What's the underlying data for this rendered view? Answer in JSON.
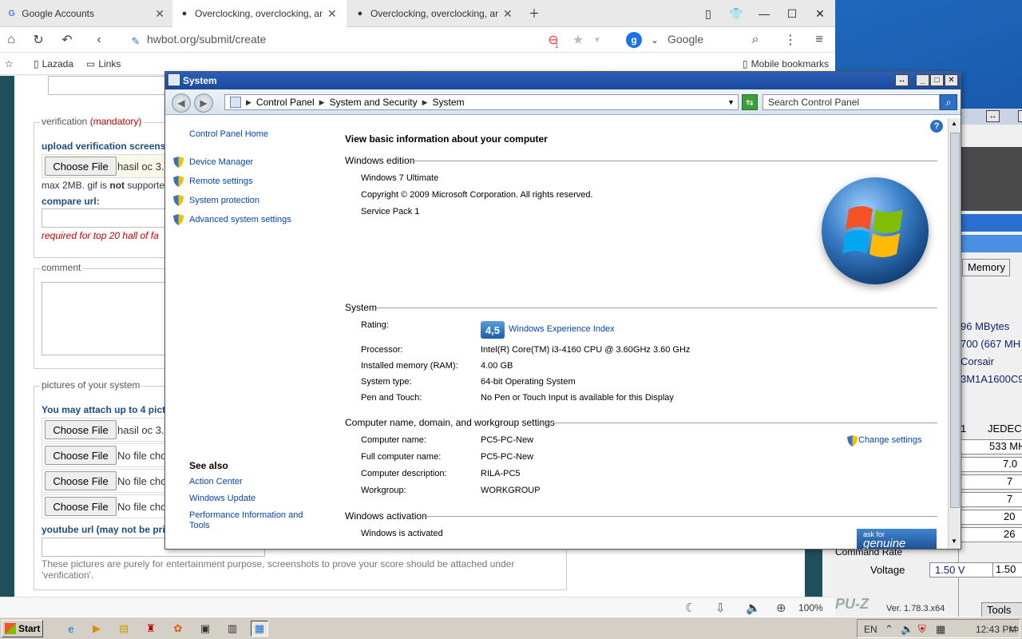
{
  "browser": {
    "tabs": [
      {
        "label": "Google Accounts",
        "active": false
      },
      {
        "label": "Overclocking, overclocking, and more",
        "active": true
      },
      {
        "label": "Overclocking, overclocking, and more",
        "active": false
      }
    ],
    "url": "hwbot.org/submit/create",
    "search_engine": "Google",
    "bookmarks": [
      "Lazada",
      "Links"
    ],
    "mobile_bookmarks": "Mobile bookmarks",
    "zoom": "100%",
    "blocked_count": "1"
  },
  "form": {
    "verification_legend": "verification",
    "mandatory": "(mandatory)",
    "upload_label": "upload verification screens",
    "choose_file": "Choose File",
    "file_selected": "hasil oc 3.",
    "max_note_a": "max 2MB. gif is ",
    "max_note_b": "not",
    "max_note_c": " supporte",
    "compare_url": "compare url:",
    "required_note": "required for top 20 hall of fa",
    "comment_legend": "comment",
    "pictures_legend": "pictures of your system",
    "attach_label": "You may attach up to 4 pictu",
    "pictures": [
      "hasil oc 3.",
      "No file cho",
      "No file cho",
      "No file cho"
    ],
    "youtube_label": "youtube url (may not be priv",
    "pictures_note": "These pictures are purely for entertainment purpose, screenshots to prove your score should be attached under 'verification'."
  },
  "system_window": {
    "title": "System",
    "breadcrumbs": [
      "Control Panel",
      "System and Security",
      "System"
    ],
    "search_placeholder": "Search Control Panel",
    "left_links": {
      "home": "Control Panel Home",
      "tasks": [
        "Device Manager",
        "Remote settings",
        "System protection",
        "Advanced system settings"
      ],
      "see_also": "See also",
      "see_also_links": [
        "Action Center",
        "Windows Update",
        "Performance Information and Tools"
      ]
    },
    "heading": "View basic information about your computer",
    "edition": {
      "title": "Windows edition",
      "name": "Windows 7 Ultimate",
      "copyright": "Copyright © 2009 Microsoft Corporation.  All rights reserved.",
      "service_pack": "Service Pack 1"
    },
    "system": {
      "title": "System",
      "rating_label": "Rating:",
      "rating_value": "4,5",
      "rating_link": "Windows Experience Index",
      "rows": [
        {
          "k": "Processor:",
          "v": "Intel(R) Core(TM) i3-4160 CPU @ 3.60GHz   3.60 GHz"
        },
        {
          "k": "Installed memory (RAM):",
          "v": "4.00 GB"
        },
        {
          "k": "System type:",
          "v": "64-bit Operating System"
        },
        {
          "k": "Pen and Touch:",
          "v": "No Pen or Touch Input is available for this Display"
        }
      ]
    },
    "computer": {
      "title": "Computer name, domain, and workgroup settings",
      "change": "Change settings",
      "rows": [
        {
          "k": "Computer name:",
          "v": "PC5-PC-New"
        },
        {
          "k": "Full computer name:",
          "v": "PC5-PC-New"
        },
        {
          "k": "Computer description:",
          "v": "RILA-PC5"
        },
        {
          "k": "Workgroup:",
          "v": "WORKGROUP"
        }
      ]
    },
    "activation": {
      "title": "Windows activation",
      "status": "Windows is activated",
      "genuine_a": "ask for",
      "genuine_b": "genuine"
    }
  },
  "cpuz": {
    "memory_tab": "Memory",
    "size": "96 MBytes",
    "freq": "700 (667 MH",
    "manuf": "Corsair",
    "part": "3M1A1600C9",
    "jedec_a": "1",
    "jedec_b": "JEDEC",
    "jedec_freq": "533 MH",
    "timings": [
      "7.0",
      "7",
      "7",
      "20",
      "26"
    ],
    "command_rate": "Command Rate",
    "voltage_label": "Voltage",
    "voltage_a": "1.50 V",
    "voltage_b": "1.50",
    "version": "Ver. 1.78.3.x64",
    "tools": "Tools",
    "logo_frag": "PU-Z"
  },
  "taskbar": {
    "start": "Start",
    "lang": "EN",
    "time": "12:43 PM"
  }
}
